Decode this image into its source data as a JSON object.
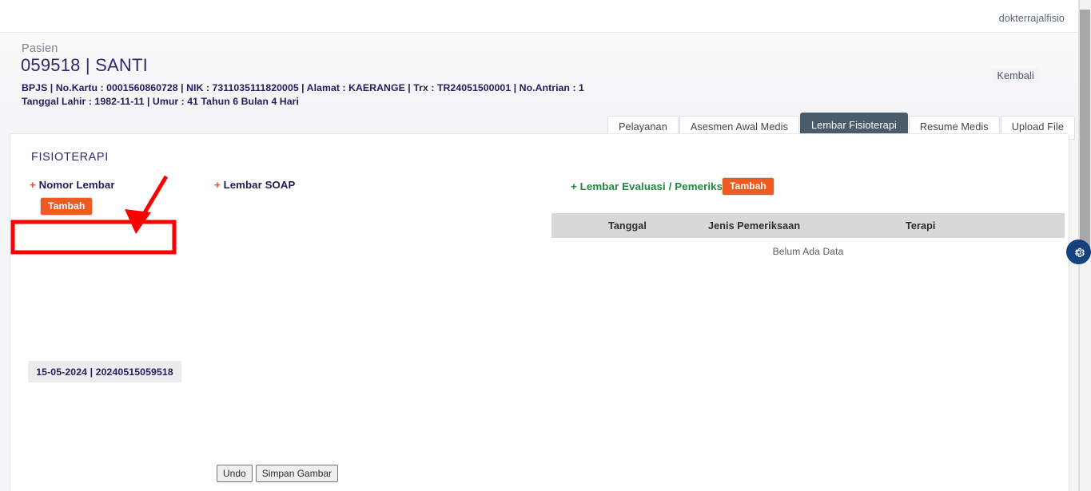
{
  "topbar": {
    "username": "dokterrajalfisio"
  },
  "patient": {
    "label": "Pasien",
    "name": "059518 | SANTI",
    "line1": "BPJS | No.Kartu : 0001560860728 | NIK : 7311035111820005 | Alamat : KAERANGE | Trx : TR24051500001 | No.Antrian : 1",
    "line2": "Tanggal Lahir : 1982-11-11 | Umur : 41 Tahun 6 Bulan 4 Hari",
    "back_label": "Kembali"
  },
  "tabs": [
    {
      "label": "Pelayanan",
      "active": false
    },
    {
      "label": "Asesmen Awal Medis",
      "active": false
    },
    {
      "label": "Lembar Fisioterapi",
      "active": true
    },
    {
      "label": "Resume Medis",
      "active": false
    },
    {
      "label": "Upload File",
      "active": false
    }
  ],
  "card": {
    "section_title": "FISIOTERAPI",
    "nomor_lembar": {
      "plus": "+",
      "label": " Nomor Lembar",
      "add_button": "Tambah",
      "items": [
        {
          "text": "15-05-2024 | 20240515059518",
          "highlighted": true
        }
      ]
    },
    "lembar_soap": {
      "plus": "+",
      "label": " Lembar SOAP",
      "undo_button": "Undo",
      "save_button": "Simpan Gambar"
    },
    "evaluasi": {
      "label": "+ Lembar Evaluasi / Pemeriksaan",
      "add_button": "Tambah",
      "columns": [
        "Tanggal",
        "Jenis Pemeriksaan",
        "Terapi"
      ],
      "empty_message": "Belum Ada Data",
      "rows": []
    }
  },
  "fab": {
    "icon": "gear-icon"
  },
  "colors": {
    "accent_orange": "#ef5a21",
    "tab_active_bg": "#4a5c6a",
    "heading_navy": "#2d2a70",
    "eval_green": "#1f8a3e",
    "annotation_red": "#fa0000",
    "fab_blue": "#15427c"
  }
}
